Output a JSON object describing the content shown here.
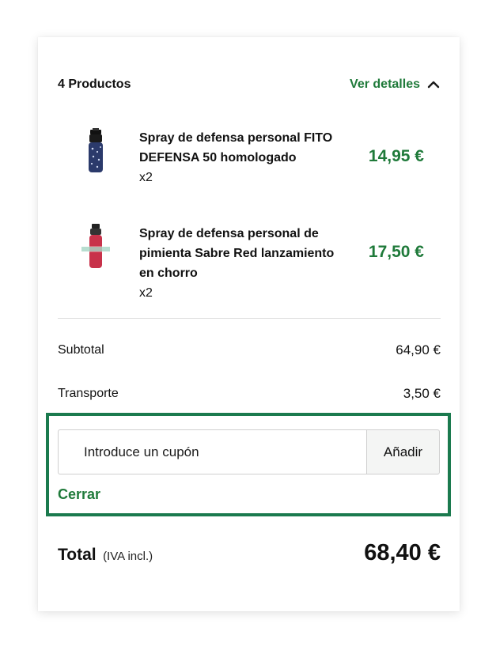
{
  "summary": {
    "products_count": "4 Productos",
    "details_label": "Ver detalles"
  },
  "products": [
    {
      "name": "Spray de defensa personal FITO DEFENSA 50 homologado",
      "qty": "x2",
      "price": "14,95 €",
      "icon": "pepper-spray-blue-icon"
    },
    {
      "name": "Spray de defensa personal de pimienta Sabre Red lanzamiento en chorro",
      "qty": "x2",
      "price": "17,50 €",
      "icon": "pepper-spray-red-icon"
    }
  ],
  "totals": {
    "subtotal_label": "Subtotal",
    "subtotal_value": "64,90 €",
    "shipping_label": "Transporte",
    "shipping_value": "3,50 €",
    "total_label": "Total",
    "total_note": "(IVA incl.)",
    "total_value": "68,40 €"
  },
  "coupon": {
    "placeholder": "Introduce un cupón",
    "apply_label": "Añadir",
    "close_label": "Cerrar"
  },
  "colors": {
    "accent_green": "#1f7a3a",
    "highlight_border": "#1b7a4e"
  }
}
